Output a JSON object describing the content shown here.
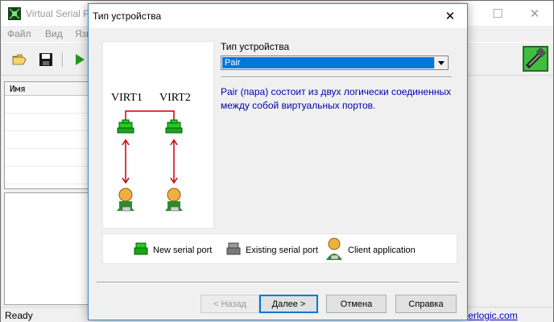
{
  "main_window": {
    "title": "Virtual Serial Po",
    "menu": [
      "Файл",
      "Вид",
      "Язы"
    ],
    "list_header": "Имя",
    "status_text": "Ready",
    "status_link": "terlogic.com"
  },
  "dialog": {
    "title": "Тип устройства",
    "field_label": "Тип устройства",
    "select_value": "Pair",
    "description": "Pair (пара) состоит из двух логически соединенных между собой виртуальных портов.",
    "diagram": {
      "port1_label": "VIRT1",
      "port2_label": "VIRT2"
    },
    "legend": {
      "new_port": "New serial port",
      "existing_port": "Existing serial port",
      "client_app": "Client application"
    },
    "buttons": {
      "back": "< Назад",
      "next": "Далее >",
      "cancel": "Отмена",
      "help": "Справка"
    }
  },
  "colors": {
    "accent": "#0078d7",
    "new_port": "#22cc22",
    "existing_port": "#808080",
    "link_line": "#cc0000",
    "description_text": "#0000aa"
  },
  "icons": [
    "app-icon",
    "open-folder-icon",
    "save-icon",
    "run-icon",
    "port-device-icon",
    "new-port-icon",
    "existing-port-icon",
    "client-app-icon",
    "close-icon",
    "minimize-icon",
    "maximize-icon",
    "chevron-down-icon"
  ]
}
